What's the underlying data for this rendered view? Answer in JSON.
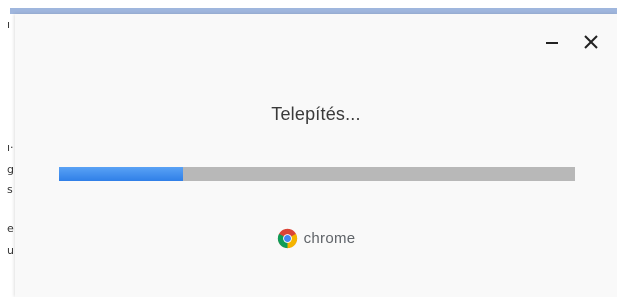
{
  "dialog": {
    "title": "Telepítés...",
    "progress": 0.24,
    "brand_name": "chrome",
    "icons": {
      "minimize": "minimize-icon",
      "close": "close-icon",
      "logo": "chrome-logo-icon"
    },
    "colors": {
      "progress_fill": "#3d8bef",
      "progress_track": "#b8b8b8",
      "background": "#f9f9f9"
    }
  },
  "background_window": {
    "fragments": [
      "ı·",
      "g",
      "s",
      "e",
      "u"
    ]
  }
}
